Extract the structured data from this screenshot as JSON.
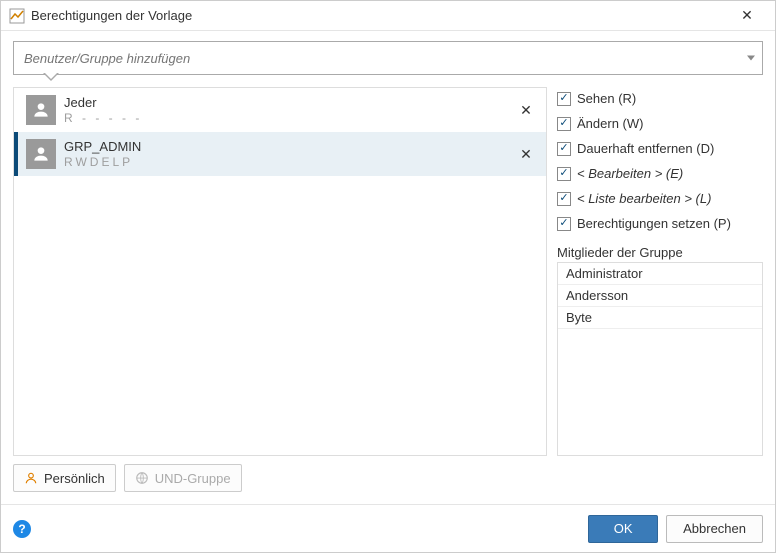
{
  "window": {
    "title": "Berechtigungen der Vorlage"
  },
  "search": {
    "placeholder": "Benutzer/Gruppe hinzufügen"
  },
  "entries": [
    {
      "name": "Jeder",
      "perms": "R - - - - -",
      "selected": false
    },
    {
      "name": "GRP_ADMIN",
      "perms": "RWDELP",
      "selected": true
    }
  ],
  "permissions": [
    {
      "label": "Sehen (R)",
      "checked": true,
      "italic": false
    },
    {
      "label": "Ändern (W)",
      "checked": true,
      "italic": false
    },
    {
      "label": "Dauerhaft entfernen (D)",
      "checked": true,
      "italic": false
    },
    {
      "label": "< Bearbeiten > (E)",
      "checked": true,
      "italic": true
    },
    {
      "label": "< Liste bearbeiten > (L)",
      "checked": true,
      "italic": true
    },
    {
      "label": "Berechtigungen setzen (P)",
      "checked": true,
      "italic": false
    }
  ],
  "members_header": "Mitglieder der Gruppe",
  "members": [
    "Administrator",
    "Andersson",
    "Byte"
  ],
  "buttons": {
    "personal": "Persönlich",
    "und_group": "UND-Gruppe",
    "ok": "OK",
    "cancel": "Abbrechen"
  }
}
